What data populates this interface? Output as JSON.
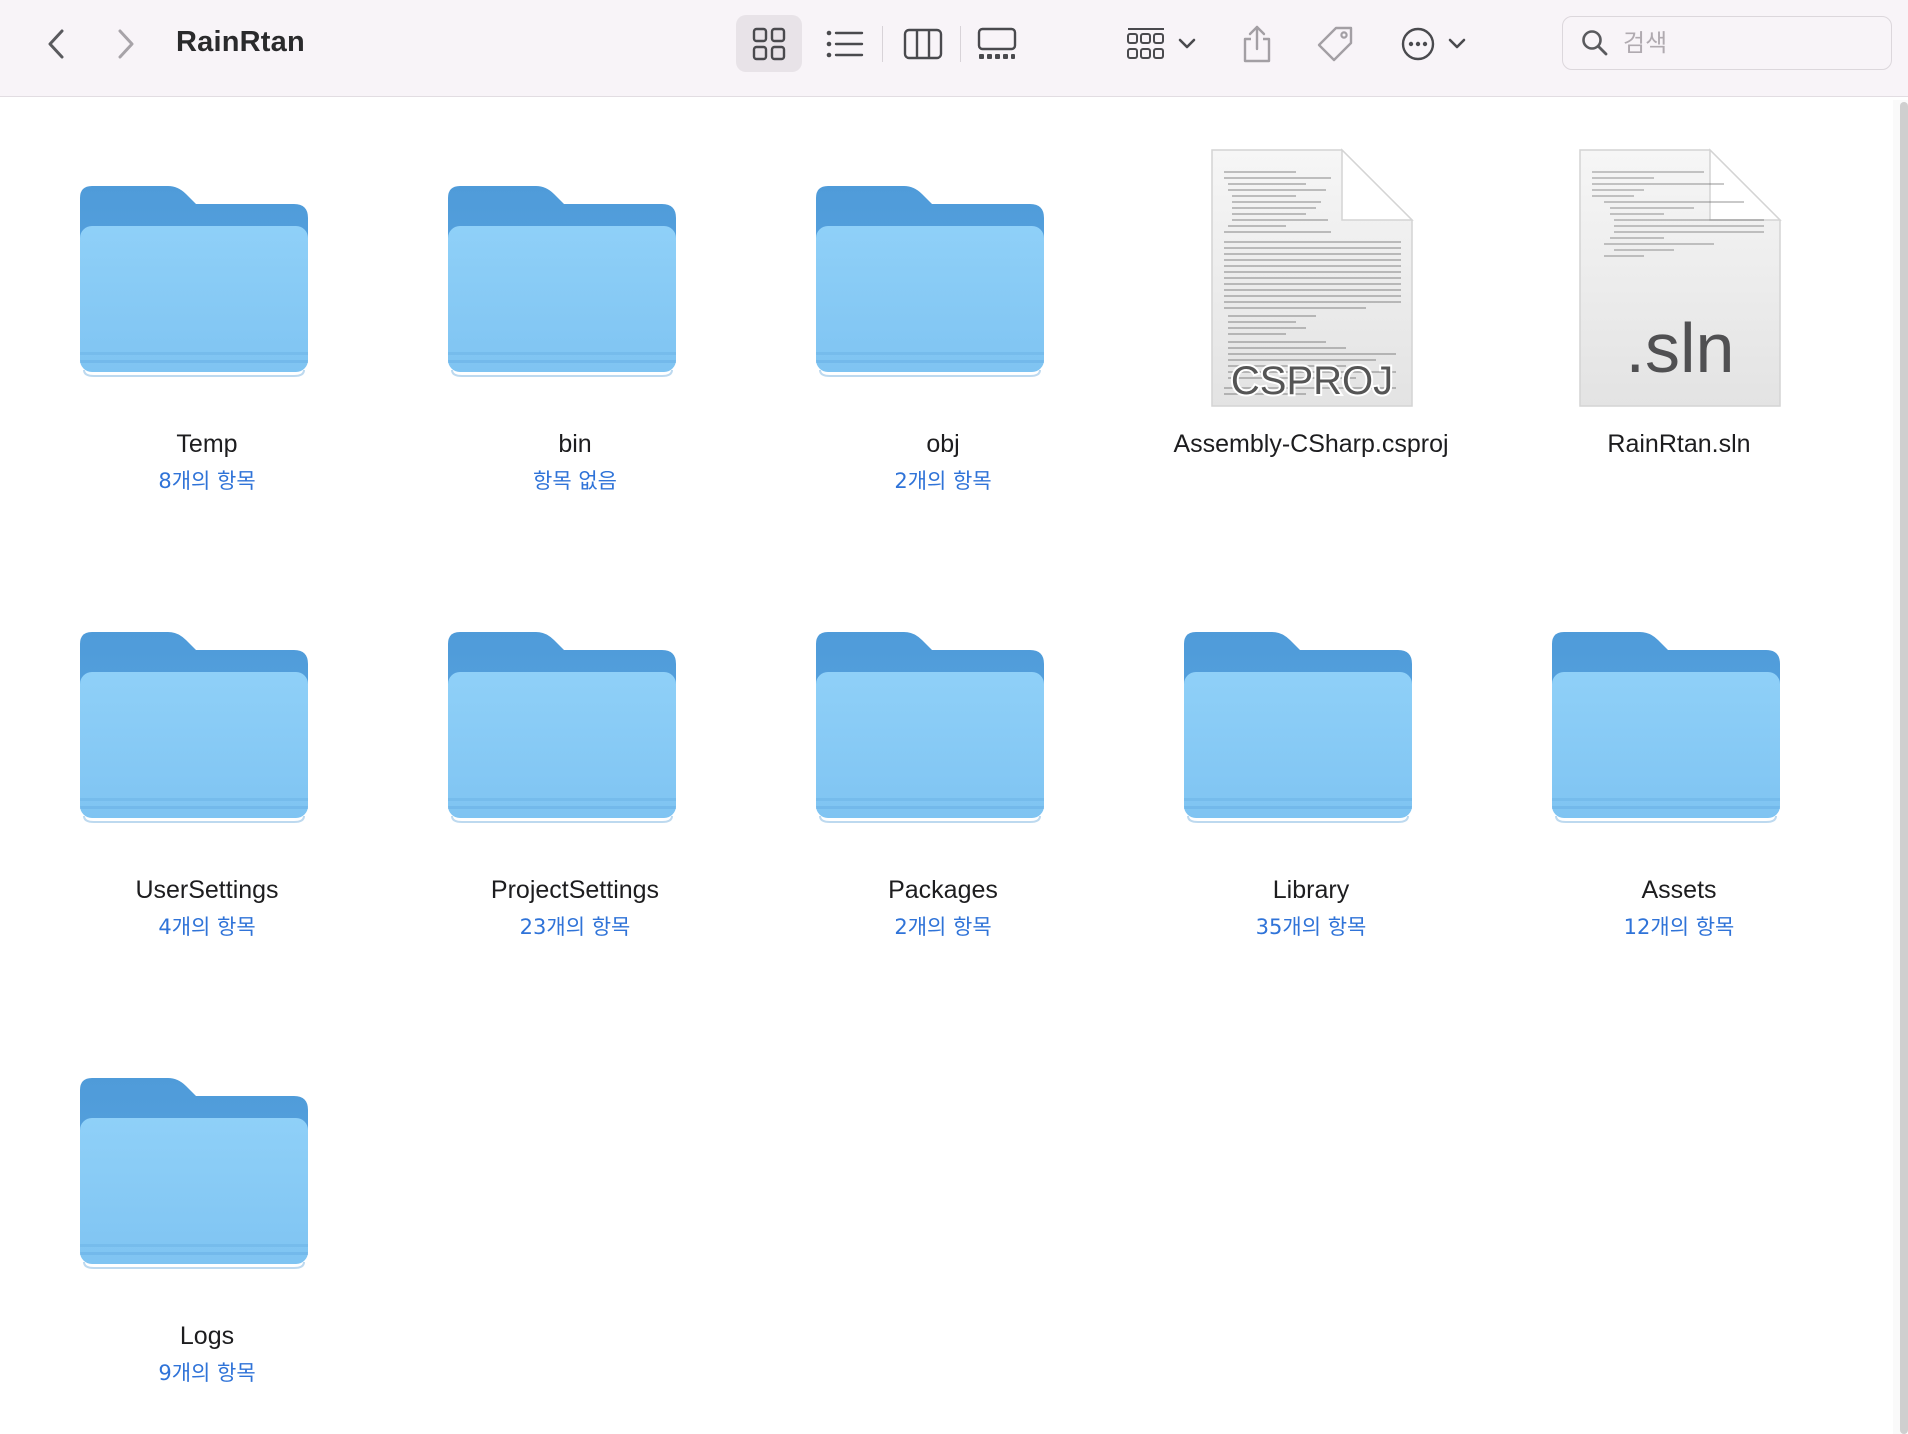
{
  "window": {
    "title": "RainRtan"
  },
  "search": {
    "placeholder": "검색"
  },
  "items": [
    {
      "name": "Temp",
      "count": "8개의 항목",
      "kind": "folder"
    },
    {
      "name": "bin",
      "count": "항목 없음",
      "kind": "folder"
    },
    {
      "name": "obj",
      "count": "2개의 항목",
      "kind": "folder"
    },
    {
      "name": "Assembly-CSharp.csproj",
      "count": "",
      "kind": "document",
      "badge": "CSPROJ"
    },
    {
      "name": "RainRtan.sln",
      "count": "",
      "kind": "document",
      "badge": ".sln"
    },
    {
      "name": "UserSettings",
      "count": "4개의 항목",
      "kind": "folder"
    },
    {
      "name": "ProjectSettings",
      "count": "23개의 항목",
      "kind": "folder"
    },
    {
      "name": "Packages",
      "count": "2개의 항목",
      "kind": "folder"
    },
    {
      "name": "Library",
      "count": "35개의 항목",
      "kind": "folder"
    },
    {
      "name": "Assets",
      "count": "12개의 항목",
      "kind": "folder"
    },
    {
      "name": "Logs",
      "count": "9개의 항목",
      "kind": "folder"
    }
  ],
  "colors": {
    "folder_front": "#86c9f4",
    "folder_back": "#5ba6e0",
    "count_text": "#2f73d8",
    "toolbar_bg": "#f8f4f8"
  }
}
